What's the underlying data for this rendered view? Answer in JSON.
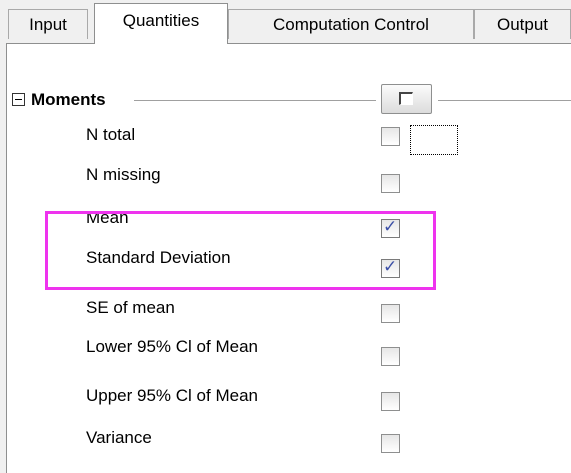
{
  "tabs": [
    {
      "label": "Input",
      "active": false
    },
    {
      "label": "Quantities",
      "active": true
    },
    {
      "label": "Computation Control",
      "active": false
    },
    {
      "label": "Output",
      "active": false
    }
  ],
  "group": {
    "title": "Moments",
    "expanded": true,
    "select_all_checked": false
  },
  "rows": [
    {
      "label": "N total",
      "checked": false
    },
    {
      "label": "N missing",
      "checked": false
    },
    {
      "label": "Mean",
      "checked": true
    },
    {
      "label": "Standard Deviation",
      "checked": true
    },
    {
      "label": "SE of mean",
      "checked": false
    },
    {
      "label": "Lower 95% Cl of Mean",
      "checked": false
    },
    {
      "label": "Upper 95% Cl of Mean",
      "checked": false
    },
    {
      "label": "Variance",
      "checked": false
    }
  ],
  "colors": {
    "highlight": "#ee33ee",
    "checkmark": "#3b4fa6"
  }
}
